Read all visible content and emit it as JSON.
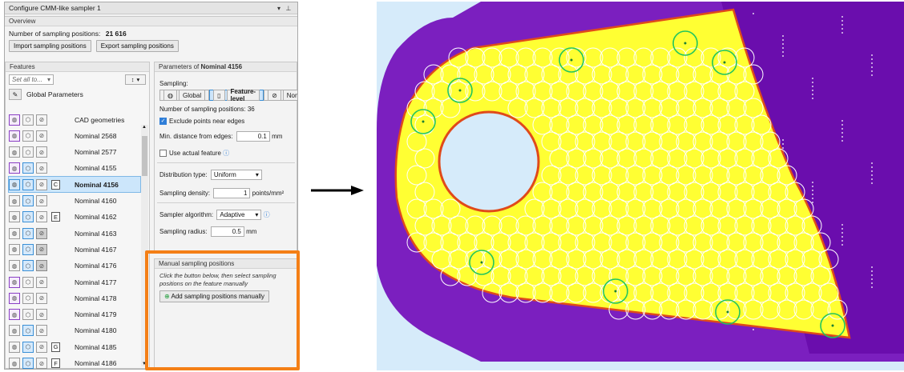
{
  "window": {
    "title": "Configure CMM-like sampler 1",
    "menu_icon": "chevron-down",
    "pin_icon": "pin"
  },
  "overview": {
    "header": "Overview",
    "count_label": "Number of sampling positions:",
    "count_value": "21 616",
    "import_label": "Import sampling positions",
    "export_label": "Export sampling positions"
  },
  "features": {
    "header": "Features",
    "set_all_placeholder": "Set all to...",
    "sort_label": "↕",
    "global_label": "Global Parameters",
    "cad_label": "CAD geometries",
    "rows": [
      {
        "name": "Nominal 2568",
        "badge": ""
      },
      {
        "name": "Nominal 2577",
        "badge": ""
      },
      {
        "name": "Nominal 4155",
        "badge": ""
      },
      {
        "name": "Nominal 4156",
        "badge": "C"
      },
      {
        "name": "Nominal 4160",
        "badge": ""
      },
      {
        "name": "Nominal 4162",
        "badge": "E"
      },
      {
        "name": "Nominal 4163",
        "badge": ""
      },
      {
        "name": "Nominal 4167",
        "badge": ""
      },
      {
        "name": "Nominal 4176",
        "badge": ""
      },
      {
        "name": "Nominal 4177",
        "badge": ""
      },
      {
        "name": "Nominal 4178",
        "badge": ""
      },
      {
        "name": "Nominal 4179",
        "badge": ""
      },
      {
        "name": "Nominal 4180",
        "badge": ""
      },
      {
        "name": "Nominal 4185",
        "badge": "G"
      },
      {
        "name": "Nominal 4186",
        "badge": "F"
      }
    ]
  },
  "params": {
    "header_prefix": "Parameters of",
    "header_name": "Nominal 4156",
    "sampling_label": "Sampling:",
    "opt_global": "Global",
    "opt_feature": "Feature-level",
    "opt_none": "None",
    "count_label": "Number of sampling positions:",
    "count_value": "36",
    "exclude_label": "Exclude points near edges",
    "min_dist_label": "Min. distance from edges:",
    "min_dist_value": "0.1",
    "min_dist_unit": "mm",
    "actual_label": "Use actual feature",
    "dist_type_label": "Distribution type:",
    "dist_type_value": "Uniform",
    "density_label": "Sampling density:",
    "density_value": "1",
    "density_unit": "points/mm²",
    "algo_label": "Sampler algorithm:",
    "algo_value": "Adaptive",
    "radius_label": "Sampling radius:",
    "radius_value": "0.5",
    "radius_unit": "mm"
  },
  "manual": {
    "header": "Manual sampling positions",
    "note": "Click the button below, then select sampling positions on the feature manually",
    "button_label": "Add sampling positions manually"
  },
  "colors": {
    "accent_orange": "#f47f16",
    "selection_blue": "#cce6fb",
    "part_yellow": "#ffff33",
    "part_purple": "#6a0dad",
    "hole_blue": "#d6ebfa",
    "manual_green": "#22c55e"
  }
}
